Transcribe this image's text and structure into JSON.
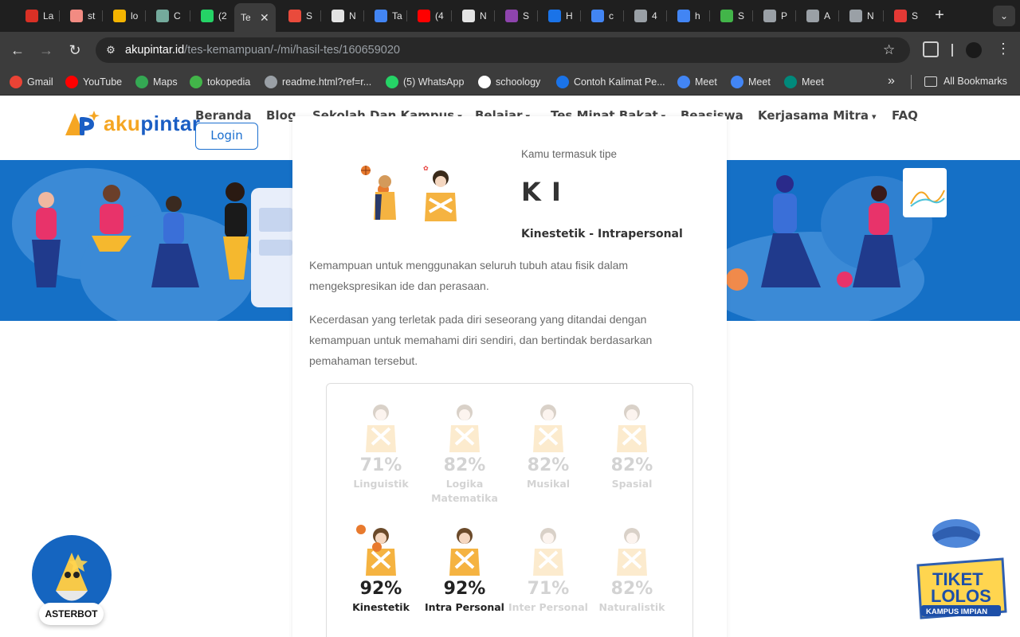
{
  "browser": {
    "tabs": [
      {
        "title": "La",
        "color": "#d93025"
      },
      {
        "title": "st",
        "color": "#f28b82"
      },
      {
        "title": "lo",
        "color": "#f4b400"
      },
      {
        "title": "C",
        "color": "#74aa9c"
      },
      {
        "title": "(2",
        "color": "#25d366"
      },
      {
        "title": "Te",
        "color": "#ffffff"
      },
      {
        "title": "S",
        "color": "#e94b3c"
      },
      {
        "title": "N",
        "color": "#e3e3e3"
      },
      {
        "title": "Ta",
        "color": "#4285f4"
      },
      {
        "title": "(4",
        "color": "#ff0000"
      },
      {
        "title": "N",
        "color": "#e3e3e3"
      },
      {
        "title": "S",
        "color": "#8e44ad"
      },
      {
        "title": "H",
        "color": "#1a73e8"
      },
      {
        "title": "c",
        "color": "#4285f4"
      },
      {
        "title": "4",
        "color": "#9aa0a6"
      },
      {
        "title": "h",
        "color": "#4285f4"
      },
      {
        "title": "S",
        "color": "#42b549"
      },
      {
        "title": "P",
        "color": "#9aa0a6"
      },
      {
        "title": "A",
        "color": "#9aa0a6"
      },
      {
        "title": "N",
        "color": "#9aa0a6"
      },
      {
        "title": "S",
        "color": "#e53935"
      }
    ],
    "new_tab": "+",
    "tab_menu": "⌄",
    "url_host": "akupintar.id",
    "url_path": "/tes-kemampuan/-/mi/hasil-tes/160659020",
    "bookmarks": [
      {
        "label": "Gmail",
        "color": "#ea4335"
      },
      {
        "label": "YouTube",
        "color": "#ff0000"
      },
      {
        "label": "Maps",
        "color": "#34a853"
      },
      {
        "label": "tokopedia",
        "color": "#42b549"
      },
      {
        "label": "readme.html?ref=r...",
        "color": "#9aa0a6"
      },
      {
        "label": "(5) WhatsApp",
        "color": "#25d366"
      },
      {
        "label": "schoology",
        "color": "#ffffff"
      },
      {
        "label": "Contoh Kalimat Pe...",
        "color": "#1a73e8"
      },
      {
        "label": "Meet",
        "color": "#4285f4"
      },
      {
        "label": "Meet",
        "color": "#4285f4"
      },
      {
        "label": "Meet",
        "color": "#00897b"
      }
    ],
    "more_bookmarks": "»",
    "all_bookmarks": "All Bookmarks"
  },
  "site": {
    "logo_a": "aku",
    "logo_b": "pintar",
    "nav": [
      {
        "label": "Beranda",
        "has_menu": false
      },
      {
        "label": "Blog",
        "has_menu": false
      },
      {
        "label": "Sekolah Dan Kampus",
        "has_menu": true
      },
      {
        "label": "Belajar",
        "has_menu": true
      },
      {
        "label": "Tes Minat Bakat",
        "has_menu": true
      },
      {
        "label": "Beasiswa",
        "has_menu": false
      },
      {
        "label": "Kerjasama Mitra",
        "has_menu": true
      },
      {
        "label": "FAQ",
        "has_menu": false
      }
    ],
    "login": "Login"
  },
  "result": {
    "type_label": "Kamu termasuk tipe",
    "type_code": "K I",
    "type_name": "Kinestetik - Intrapersonal",
    "desc_1": "Kemampuan untuk menggunakan seluruh tubuh atau fisik dalam mengekspresikan ide dan perasaan.",
    "desc_2": "Kecerdasan yang terletak pada diri seseorang yang ditandai dengan kemampuan untuk memahami diri sendiri, dan bertindak berdasarkan pemahaman tersebut.",
    "scores": [
      {
        "name": "Linguistik",
        "pct": "71%",
        "active": false,
        "icon": "linguistic-character-icon"
      },
      {
        "name": "Logika Matematika",
        "pct": "82%",
        "active": false,
        "icon": "logic-character-icon"
      },
      {
        "name": "Musikal",
        "pct": "82%",
        "active": false,
        "icon": "music-character-icon"
      },
      {
        "name": "Spasial",
        "pct": "82%",
        "active": false,
        "icon": "spatial-character-icon"
      },
      {
        "name": "Kinestetik",
        "pct": "92%",
        "active": true,
        "icon": "kinesthetic-character-icon"
      },
      {
        "name": "Intra Personal",
        "pct": "92%",
        "active": true,
        "icon": "intrapersonal-character-icon"
      },
      {
        "name": "Inter Personal",
        "pct": "71%",
        "active": false,
        "icon": "interpersonal-character-icon"
      },
      {
        "name": "Naturalistik",
        "pct": "82%",
        "active": false,
        "icon": "naturalist-character-icon"
      }
    ]
  },
  "widgets": {
    "asterbot": "ASTERBOT",
    "tiket_line1": "TIKET",
    "tiket_line2": "LOLOS",
    "tiket_line3": "KAMPUS IMPIAN"
  },
  "colors": {
    "brand_blue": "#1570c6",
    "brand_orange": "#f5a623",
    "chrome_dark": "#1f1f1f",
    "chrome_toolbar": "#3c3c3c"
  }
}
